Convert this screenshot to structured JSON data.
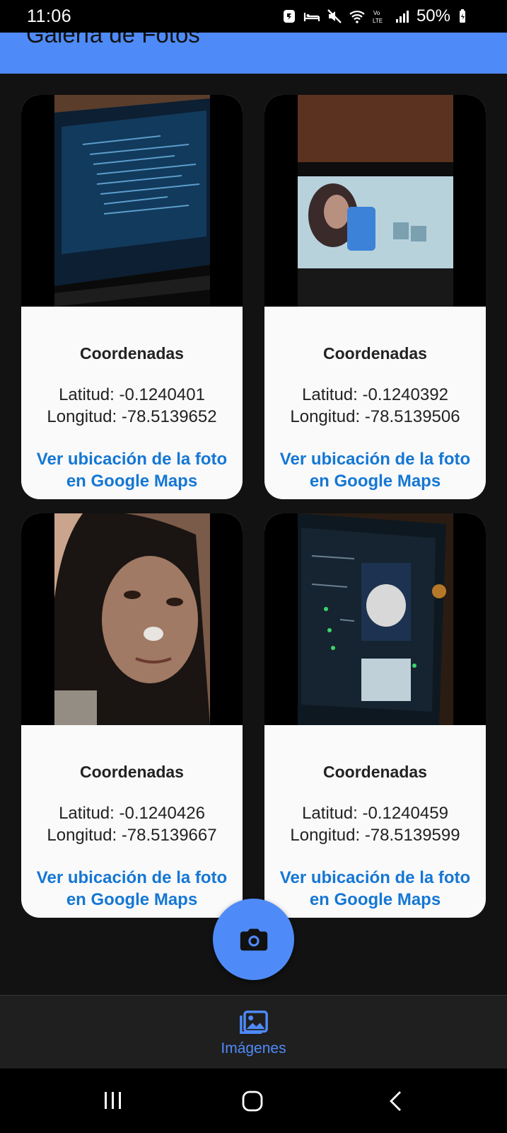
{
  "status_bar": {
    "time": "11:06",
    "battery": "50%",
    "icons": [
      "notification-icon",
      "bed-icon",
      "mute-icon",
      "wifi-icon",
      "volte-icon",
      "signal-icon",
      "battery-icon"
    ]
  },
  "app_bar": {
    "title": "Galería de Fotos"
  },
  "cards": [
    {
      "heading": "Coordenadas",
      "lat": "Latitud: -0.1240401",
      "lng": "Longitud: -78.5139652",
      "link": "Ver ubicación de la foto en Google Maps"
    },
    {
      "heading": "Coordenadas",
      "lat": "Latitud: -0.1240392",
      "lng": "Longitud: -78.5139506",
      "link": "Ver ubicación de la foto en Google Maps"
    },
    {
      "heading": "Coordenadas",
      "lat": "Latitud: -0.1240426",
      "lng": "Longitud: -78.5139667",
      "link": "Ver ubicación de la foto en Google Maps"
    },
    {
      "heading": "Coordenadas",
      "lat": "Latitud: -0.1240459",
      "lng": "Longitud: -78.5139599",
      "link": "Ver ubicación de la foto en Google Maps"
    }
  ],
  "fab": {
    "icon": "camera-icon"
  },
  "bottom_nav": {
    "items": [
      {
        "label": "Imágenes",
        "icon": "gallery-icon"
      }
    ]
  },
  "system_nav": [
    "recents-icon",
    "home-icon",
    "back-icon"
  ],
  "colors": {
    "accent": "#4f8bf8",
    "link": "#1577d4",
    "background": "#121212",
    "card": "#fafafa"
  }
}
